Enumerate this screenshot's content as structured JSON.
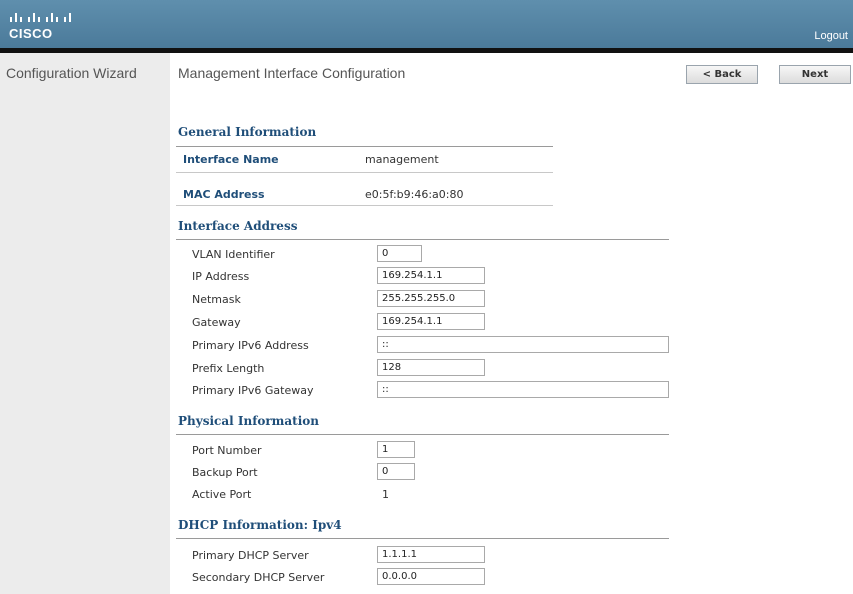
{
  "header": {
    "brand": "CISCO",
    "logout_label": "Logout"
  },
  "sidebar": {
    "title": "Configuration Wizard"
  },
  "main": {
    "title": "Management Interface Configuration",
    "back_label": "< Back",
    "next_label": "Next"
  },
  "general_info": {
    "title": "General Information",
    "interface_name_label": "Interface Name",
    "interface_name_value": "management",
    "mac_label": "MAC Address",
    "mac_value": "e0:5f:b9:46:a0:80"
  },
  "interface_address": {
    "title": "Interface Address",
    "vlan_label": "VLAN Identifier",
    "vlan_value": "0",
    "ip_label": "IP Address",
    "ip_value": "169.254.1.1",
    "netmask_label": "Netmask",
    "netmask_value": "255.255.255.0",
    "gateway_label": "Gateway",
    "gateway_value": "169.254.1.1",
    "ipv6_label": "Primary IPv6 Address",
    "ipv6_value": "::",
    "prefix_label": "Prefix Length",
    "prefix_value": "128",
    "ipv6_gw_label": "Primary IPv6 Gateway",
    "ipv6_gw_value": "::"
  },
  "physical_info": {
    "title": "Physical Information",
    "port_label": "Port Number",
    "port_value": "1",
    "backup_label": "Backup Port",
    "backup_value": "0",
    "active_label": "Active Port",
    "active_value": "1"
  },
  "dhcp_info": {
    "title": "DHCP Information: Ipv4",
    "primary_label": "Primary DHCP Server",
    "primary_value": "1.1.1.1",
    "secondary_label": "Secondary DHCP Server",
    "secondary_value": "0.0.0.0"
  },
  "colors": {
    "header": "#5f8fad",
    "section_title": "#1f4e79",
    "sidebar_bg": "#ececec"
  }
}
